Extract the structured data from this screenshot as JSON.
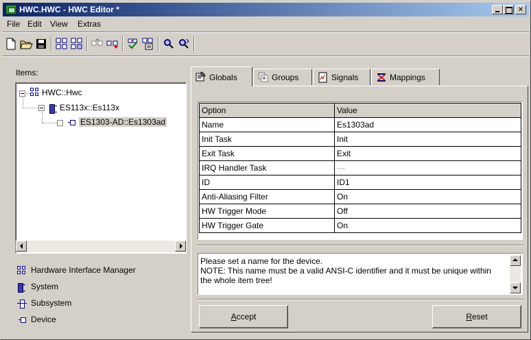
{
  "window": {
    "title": "HWC.HWC - HWC Editor  *"
  },
  "menu": [
    "File",
    "Edit",
    "View",
    "Extras"
  ],
  "toolbar": {
    "icons": [
      "new-file-icon",
      "open-folder-icon",
      "save-icon",
      "add-system-icon",
      "add-subsystem-icon",
      "move-up-icon",
      "move-down-icon",
      "check-icon",
      "generate-icon",
      "find-icon",
      "find-next-icon"
    ]
  },
  "left": {
    "items_label": "Items:",
    "tree": [
      {
        "label": "HWC::Hwc",
        "level": 0
      },
      {
        "label": "ES113x::Es113x",
        "level": 1
      },
      {
        "label": "ES1303-AD::Es1303ad",
        "level": 2,
        "selected": true
      }
    ],
    "legend": [
      {
        "icon": "hardware-interface-manager-icon",
        "label": "Hardware Interface Manager"
      },
      {
        "icon": "system-icon",
        "label": "System"
      },
      {
        "icon": "subsystem-icon",
        "label": "Subsystem"
      },
      {
        "icon": "device-icon",
        "label": "Device"
      }
    ]
  },
  "tabs": [
    {
      "label": "Globals",
      "active": true
    },
    {
      "label": "Groups",
      "active": false
    },
    {
      "label": "Signals",
      "active": false
    },
    {
      "label": "Mappings",
      "active": false
    }
  ],
  "grid": {
    "headers": [
      "Option",
      "Value"
    ],
    "rows": [
      [
        "Name",
        "Es1303ad"
      ],
      [
        "Init Task",
        "Init"
      ],
      [
        "Exit Task",
        "Exit"
      ],
      [
        "IRQ Handler Task",
        "---"
      ],
      [
        "ID",
        "ID1"
      ],
      [
        "Anti-Aliasing Filter",
        "On"
      ],
      [
        "HW Trigger Mode",
        "Off"
      ],
      [
        "HW Trigger Gate",
        "On"
      ]
    ]
  },
  "description": "Please set a name for the device.\nNOTE: This name must be a valid ANSI-C identifier and it must be unique within the whole item tree!",
  "buttons": {
    "accept": "Accept",
    "reset": "Reset"
  },
  "colors": {
    "title_start": "#0a246a",
    "title_end": "#a6caf0",
    "face": "#d4d0c8"
  }
}
